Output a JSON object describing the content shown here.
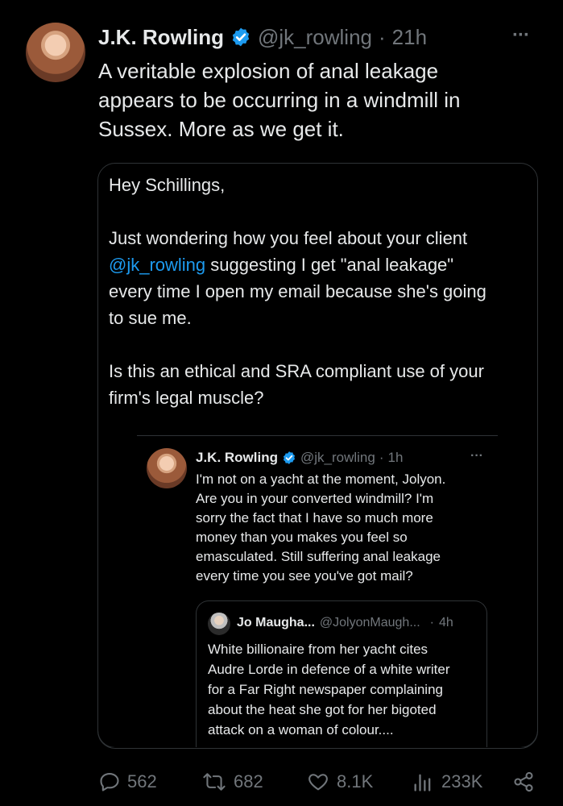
{
  "tweet": {
    "author_name": "J.K. Rowling",
    "handle": "@jk_rowling",
    "separator": "·",
    "time": "21h",
    "more": "···",
    "text_lines": [
      "A veritable explosion of anal leakage",
      "appears to be occurring in a windmill in",
      "Sussex. More as we get it."
    ]
  },
  "screenshot_card": {
    "greeting": "Hey Schillings,",
    "para1_line1": "Just wondering how you feel about your client",
    "para1_mention": "@jk_rowling",
    "para1_line2_rest": " suggesting I get \"anal leakage\"",
    "para1_line3": "every time I open my email because she's going",
    "para1_line4": "to sue me.",
    "para2_line1": "Is this an ethical and SRA compliant use of your",
    "para2_line2": "firm's legal muscle?"
  },
  "nested_reply": {
    "author_name": "J.K. Rowling",
    "handle": "@jk_rowling",
    "separator": "·",
    "time": "1h",
    "more": "···",
    "text_lines": [
      "I'm not on a yacht at the moment, Jolyon.",
      "Are you in your converted windmill? I'm",
      "sorry the fact that I have so much more",
      "money than you makes you feel so",
      "emasculated. Still suffering anal leakage",
      "every time you see you've got mail?"
    ]
  },
  "quoted_tweet": {
    "author_name": "Jo Maugha...",
    "handle": "@JolyonMaugh...",
    "separator": "·",
    "time": "4h",
    "text_lines": [
      "White billionaire from her yacht cites",
      "Audre Lorde in defence of a white writer",
      "for a Far Right newspaper complaining",
      "about the heat she got for her bigoted",
      "attack on a woman of colour...."
    ]
  },
  "actions": {
    "replies": "562",
    "reposts": "682",
    "likes": "8.1K",
    "views": "233K"
  },
  "icons": {
    "verified": "verified-badge-icon",
    "reply": "reply-icon",
    "repost": "repost-icon",
    "like": "heart-icon",
    "views": "views-icon",
    "share": "share-icon"
  },
  "colors": {
    "background": "#000000",
    "text": "#e7e9ea",
    "muted": "#71767b",
    "link": "#1d9bf0",
    "border": "#2f3336"
  }
}
